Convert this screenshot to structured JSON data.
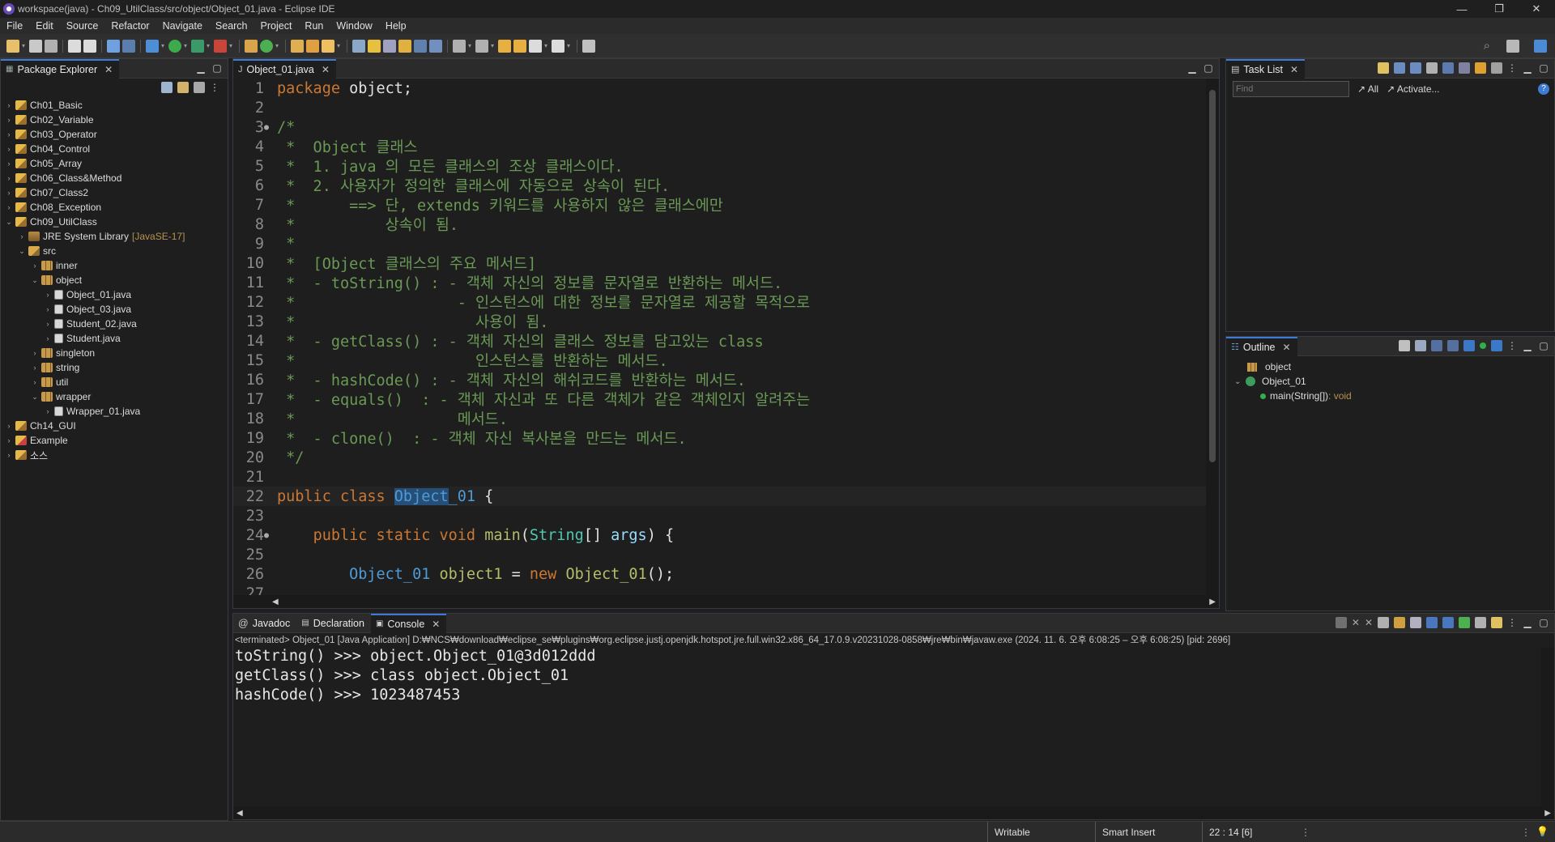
{
  "window": {
    "title": "workspace(java) - Ch09_UtilClass/src/object/Object_01.java - Eclipse IDE",
    "controls": [
      "—",
      "❐",
      "✕"
    ]
  },
  "menu": [
    "File",
    "Edit",
    "Source",
    "Refactor",
    "Navigate",
    "Search",
    "Project",
    "Run",
    "Window",
    "Help"
  ],
  "package_explorer": {
    "tab_label": "Package Explorer",
    "tree": [
      {
        "label": "Ch01_Basic",
        "depth": 0,
        "arrow": "›",
        "icon": "project"
      },
      {
        "label": "Ch02_Variable",
        "depth": 0,
        "arrow": "›",
        "icon": "project"
      },
      {
        "label": "Ch03_Operator",
        "depth": 0,
        "arrow": "›",
        "icon": "project"
      },
      {
        "label": "Ch04_Control",
        "depth": 0,
        "arrow": "›",
        "icon": "project"
      },
      {
        "label": "Ch05_Array",
        "depth": 0,
        "arrow": "›",
        "icon": "project"
      },
      {
        "label": "Ch06_Class&Method",
        "depth": 0,
        "arrow": "›",
        "icon": "project"
      },
      {
        "label": "Ch07_Class2",
        "depth": 0,
        "arrow": "›",
        "icon": "project"
      },
      {
        "label": "Ch08_Exception",
        "depth": 0,
        "arrow": "›",
        "icon": "project"
      },
      {
        "label": "Ch09_UtilClass",
        "depth": 0,
        "arrow": "⌄",
        "icon": "project"
      },
      {
        "label": "JRE System Library",
        "sub": "[JavaSE-17]",
        "depth": 1,
        "arrow": "›",
        "icon": "jre"
      },
      {
        "label": "src",
        "depth": 1,
        "arrow": "⌄",
        "icon": "src"
      },
      {
        "label": "inner",
        "depth": 2,
        "arrow": "›",
        "icon": "pkg"
      },
      {
        "label": "object",
        "depth": 2,
        "arrow": "⌄",
        "icon": "pkg"
      },
      {
        "label": "Object_01.java",
        "depth": 3,
        "arrow": "›",
        "icon": "jfile"
      },
      {
        "label": "Object_03.java",
        "depth": 3,
        "arrow": "›",
        "icon": "jfile"
      },
      {
        "label": "Student_02.java",
        "depth": 3,
        "arrow": "›",
        "icon": "jfile"
      },
      {
        "label": "Student.java",
        "depth": 3,
        "arrow": "›",
        "icon": "jfile"
      },
      {
        "label": "singleton",
        "depth": 2,
        "arrow": "›",
        "icon": "pkg"
      },
      {
        "label": "string",
        "depth": 2,
        "arrow": "›",
        "icon": "pkg"
      },
      {
        "label": "util",
        "depth": 2,
        "arrow": "›",
        "icon": "pkg"
      },
      {
        "label": "wrapper",
        "depth": 2,
        "arrow": "⌄",
        "icon": "pkg"
      },
      {
        "label": "Wrapper_01.java",
        "depth": 3,
        "arrow": "›",
        "icon": "jfile"
      },
      {
        "label": "Ch14_GUI",
        "depth": 0,
        "arrow": "›",
        "icon": "project"
      },
      {
        "label": "Example",
        "depth": 0,
        "arrow": "›",
        "icon": "proj-err"
      },
      {
        "label": "소스",
        "depth": 0,
        "arrow": "›",
        "icon": "project"
      }
    ]
  },
  "editor": {
    "tab_label": "Object_01.java",
    "lines": [
      {
        "n": "1",
        "fold": "",
        "segs": [
          [
            "kw",
            "package"
          ],
          [
            "id",
            " object;"
          ]
        ]
      },
      {
        "n": "2",
        "fold": "",
        "segs": []
      },
      {
        "n": "3",
        "fold": "●",
        "segs": [
          [
            "cm",
            "/*"
          ]
        ]
      },
      {
        "n": "4",
        "fold": "",
        "segs": [
          [
            "cm",
            " *  Object 클래스"
          ]
        ]
      },
      {
        "n": "5",
        "fold": "",
        "segs": [
          [
            "cm",
            " *  1. java 의 모든 클래스의 조상 클래스이다."
          ]
        ]
      },
      {
        "n": "6",
        "fold": "",
        "segs": [
          [
            "cm",
            " *  2. 사용자가 정의한 클래스에 자동으로 상속이 된다."
          ]
        ]
      },
      {
        "n": "7",
        "fold": "",
        "segs": [
          [
            "cm",
            " *      ==> 단, extends 키워드를 사용하지 않은 클래스에만"
          ]
        ]
      },
      {
        "n": "8",
        "fold": "",
        "segs": [
          [
            "cm",
            " *          상속이 됨."
          ]
        ]
      },
      {
        "n": "9",
        "fold": "",
        "segs": [
          [
            "cm",
            " *"
          ]
        ]
      },
      {
        "n": "10",
        "fold": "",
        "segs": [
          [
            "cm",
            " *  [Object 클래스의 주요 메서드]"
          ]
        ]
      },
      {
        "n": "11",
        "fold": "",
        "segs": [
          [
            "cm",
            " *  - toString() : - 객체 자신의 정보를 문자열로 반환하는 메서드."
          ]
        ]
      },
      {
        "n": "12",
        "fold": "",
        "segs": [
          [
            "cm",
            " *                  - 인스턴스에 대한 정보를 문자열로 제공할 목적으로"
          ]
        ]
      },
      {
        "n": "13",
        "fold": "",
        "segs": [
          [
            "cm",
            " *                    사용이 됨."
          ]
        ]
      },
      {
        "n": "14",
        "fold": "",
        "segs": [
          [
            "cm",
            " *  - getClass() : - 객체 자신의 클래스 정보를 담고있는 class"
          ]
        ]
      },
      {
        "n": "15",
        "fold": "",
        "segs": [
          [
            "cm",
            " *                    인스턴스를 반환하는 메서드."
          ]
        ]
      },
      {
        "n": "16",
        "fold": "",
        "segs": [
          [
            "cm",
            " *  - hashCode() : - 객체 자신의 해쉬코드를 반환하는 메서드."
          ]
        ]
      },
      {
        "n": "17",
        "fold": "",
        "segs": [
          [
            "cm",
            " *  - equals()  : - 객체 자신과 또 다른 객체가 같은 객체인지 알려주는"
          ]
        ]
      },
      {
        "n": "18",
        "fold": "",
        "segs": [
          [
            "cm",
            " *                  메서드."
          ]
        ]
      },
      {
        "n": "19",
        "fold": "",
        "segs": [
          [
            "cm",
            " *  - clone()  : - 객체 자신 복사본을 만드는 메서드."
          ]
        ]
      },
      {
        "n": "20",
        "fold": "",
        "segs": [
          [
            "cm",
            " */"
          ]
        ]
      },
      {
        "n": "21",
        "fold": "",
        "segs": []
      },
      {
        "n": "22",
        "fold": "",
        "current": true,
        "segs": [
          [
            "kw",
            "public class "
          ],
          [
            "cls-sel",
            "Object"
          ],
          [
            "cls",
            "_01"
          ],
          [
            "id",
            " {"
          ]
        ]
      },
      {
        "n": "23",
        "fold": "",
        "segs": []
      },
      {
        "n": "24",
        "fold": "●",
        "segs": [
          [
            "id",
            "    "
          ],
          [
            "kw",
            "public static void "
          ],
          [
            "fn",
            "main"
          ],
          [
            "id",
            "("
          ],
          [
            "ty",
            "String"
          ],
          [
            "id",
            "[] "
          ],
          [
            "var",
            "args"
          ],
          [
            "id",
            ") {"
          ]
        ]
      },
      {
        "n": "25",
        "fold": "",
        "segs": []
      },
      {
        "n": "26",
        "fold": "",
        "segs": [
          [
            "id",
            "        "
          ],
          [
            "cls",
            "Object_01"
          ],
          [
            "id",
            " "
          ],
          [
            "fn",
            "object1"
          ],
          [
            "id",
            " = "
          ],
          [
            "kw",
            "new "
          ],
          [
            "fn",
            "Object_01"
          ],
          [
            "id",
            "();"
          ]
        ]
      },
      {
        "n": "27",
        "fold": "",
        "segs": []
      }
    ]
  },
  "tasklist": {
    "tab_label": "Task List",
    "find_placeholder": "Find",
    "all_label": "All",
    "activate_label": "Activate..."
  },
  "outline": {
    "tab_label": "Outline",
    "package": "object",
    "class_name": "Object_01",
    "method_name": "main(String[])",
    "method_return": " : void"
  },
  "bottom_panel": {
    "tabs": [
      "Javadoc",
      "Declaration",
      "Console"
    ],
    "terminated": "<terminated> Object_01 [Java Application] D:₩NCS₩download₩eclipse_se₩plugins₩org.eclipse.justj.openjdk.hotspot.jre.full.win32.x86_64_17.0.9.v20231028-0858₩jre₩bin₩javaw.exe  (2024. 11. 6. 오후 6:08:25 – 오후 6:08:25) [pid: 2696]",
    "output": [
      "toString() >>> object.Object_01@3d012ddd",
      "getClass() >>> class object.Object_01",
      "hashCode() >>> 1023487453"
    ]
  },
  "status": {
    "writable": "Writable",
    "insert_mode": "Smart Insert",
    "position": "22 : 14 [6]"
  }
}
